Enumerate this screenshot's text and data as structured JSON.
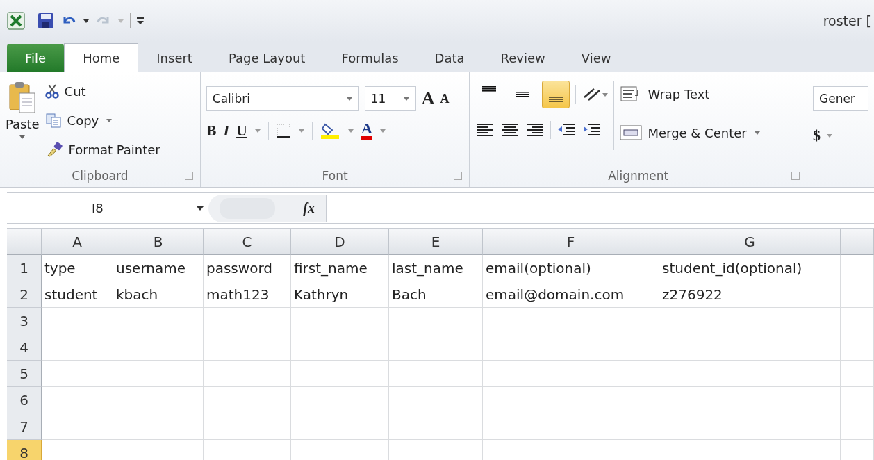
{
  "window": {
    "title": "roster ["
  },
  "tabs": [
    {
      "label": "File",
      "kind": "file",
      "selected": false
    },
    {
      "label": "Home",
      "kind": "tab",
      "selected": true
    },
    {
      "label": "Insert",
      "kind": "tab",
      "selected": false
    },
    {
      "label": "Page Layout",
      "kind": "tab",
      "selected": false
    },
    {
      "label": "Formulas",
      "kind": "tab",
      "selected": false
    },
    {
      "label": "Data",
      "kind": "tab",
      "selected": false
    },
    {
      "label": "Review",
      "kind": "tab",
      "selected": false
    },
    {
      "label": "View",
      "kind": "tab",
      "selected": false
    }
  ],
  "clipboard": {
    "paste": "Paste",
    "cut": "Cut",
    "copy": "Copy",
    "format_painter": "Format Painter",
    "label": "Clipboard"
  },
  "font": {
    "family": "Calibri",
    "size": "11",
    "grow": "A",
    "shrink": "A",
    "bold": "B",
    "italic": "I",
    "underline": "U",
    "font_color": "A",
    "label": "Font"
  },
  "alignment": {
    "vertical": [
      {
        "selected": false
      },
      {
        "selected": false
      },
      {
        "selected": true
      }
    ],
    "wrap_text": "Wrap Text",
    "merge_center": "Merge & Center",
    "label": "Alignment"
  },
  "number": {
    "format": "Gener",
    "currency": "$"
  },
  "formula_bar": {
    "name_box": "I8",
    "fx": "fx"
  },
  "sheet": {
    "columns": [
      "A",
      "B",
      "C",
      "D",
      "E",
      "F",
      "G"
    ],
    "rows": [
      {
        "label": "1",
        "selected": false,
        "cells": [
          "type",
          "username",
          "password",
          "first_name",
          "last_name",
          "email(optional)",
          "student_id(optional)"
        ]
      },
      {
        "label": "2",
        "selected": false,
        "cells": [
          "student",
          "kbach",
          "math123",
          "Kathryn",
          "Bach",
          "email@domain.com",
          "z276922"
        ]
      },
      {
        "label": "3",
        "selected": false,
        "cells": []
      },
      {
        "label": "4",
        "selected": false,
        "cells": []
      },
      {
        "label": "5",
        "selected": false,
        "cells": []
      },
      {
        "label": "6",
        "selected": false,
        "cells": []
      },
      {
        "label": "7",
        "selected": false,
        "cells": []
      },
      {
        "label": "8",
        "selected": true,
        "cells": []
      }
    ]
  }
}
